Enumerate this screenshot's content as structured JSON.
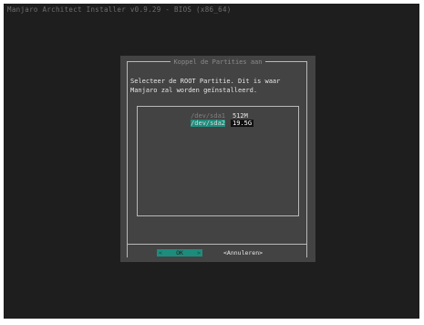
{
  "backtitle": "Manjaro Architect Installer v0.9.29 - BIOS (x86_64)",
  "dialog": {
    "title": "Koppel de Partities aan",
    "prompt_line1": "Selecteer de ROOT Partitie. Dit is waar",
    "prompt_line2": "Manjaro zal worden geïnstalleerd."
  },
  "partitions": [
    {
      "tag_prefix": "/dev/sda1",
      "size": "512M",
      "selected": false
    },
    {
      "tag_prefix": "/dev/sda2",
      "size": "19.5G",
      "selected": true
    }
  ],
  "buttons": {
    "ok_lt": "<",
    "ok": "OK",
    "ok_gt": ">",
    "cancel": "<Annuleren>"
  },
  "colors": {
    "background": "#1e1e1e",
    "dialog": "#434343",
    "accent": "#1e8c7c"
  }
}
